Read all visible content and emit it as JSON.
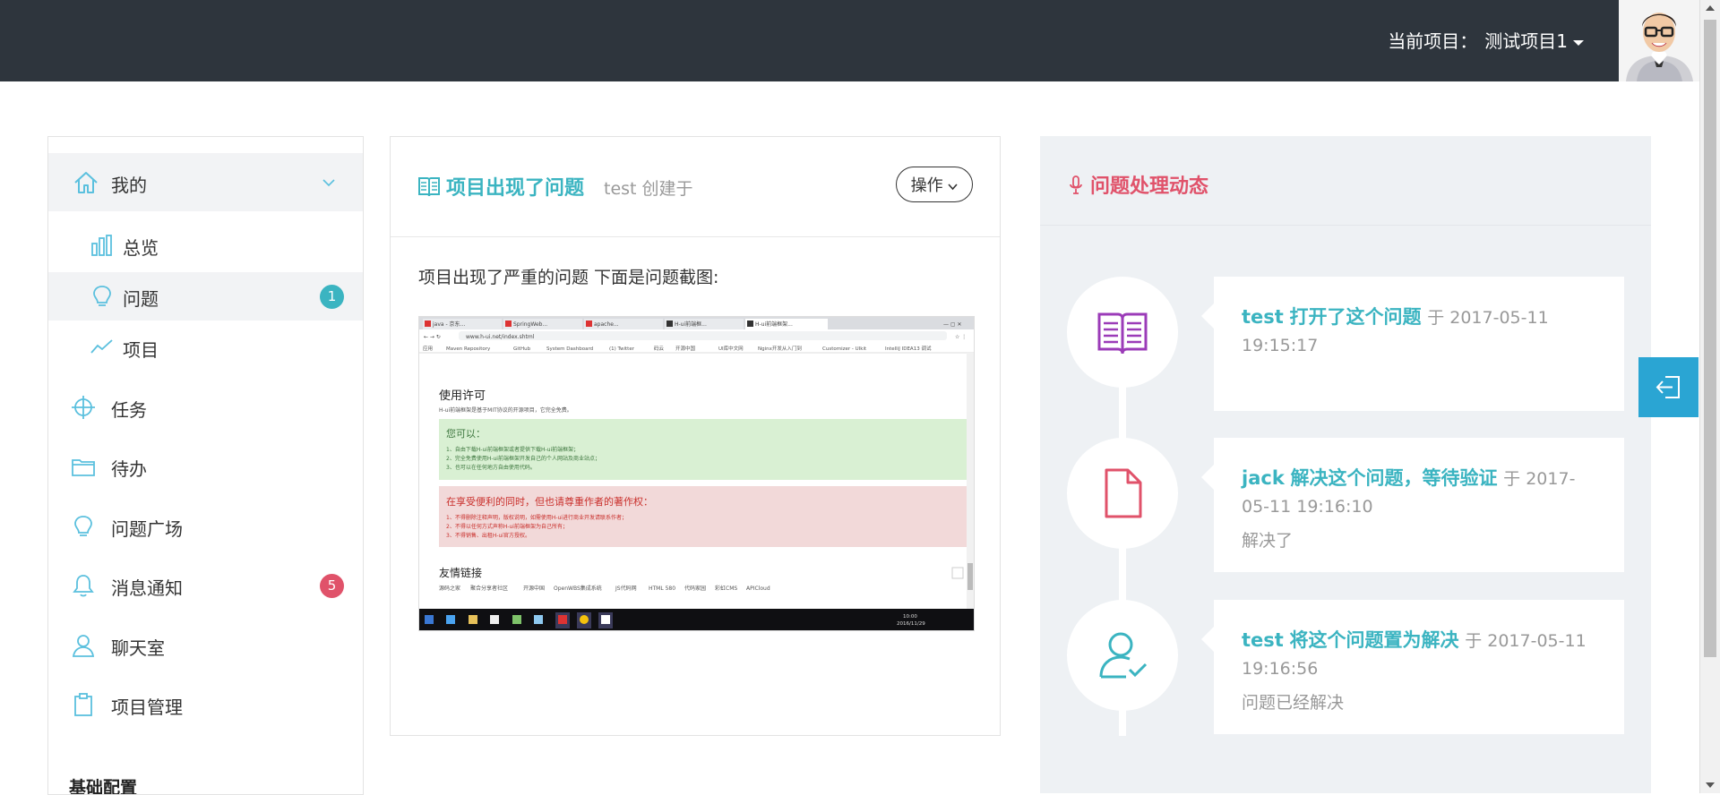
{
  "header": {
    "project_label": "当前项目：",
    "project_name": "测试项目1"
  },
  "sidebar": {
    "group": "我的",
    "items": [
      {
        "label": "总览",
        "icon": "bar-chart-icon"
      },
      {
        "label": "问题",
        "icon": "lightbulb-icon",
        "badge": "1",
        "badge_color": "#3bb4c1"
      },
      {
        "label": "项目",
        "icon": "trend-line-icon"
      },
      {
        "label": "任务",
        "icon": "crosshair-icon"
      },
      {
        "label": "待办",
        "icon": "folder-icon"
      },
      {
        "label": "问题广场",
        "icon": "lightbulb-icon"
      },
      {
        "label": "消息通知",
        "icon": "bell-icon",
        "badge": "5",
        "badge_color": "#e0526a"
      },
      {
        "label": "聊天室",
        "icon": "user-icon"
      },
      {
        "label": "项目管理",
        "icon": "clipboard-icon"
      }
    ],
    "section": "基础配置"
  },
  "issue": {
    "title": "项目出现了问题",
    "author": "test",
    "created": "创建于",
    "action_button": "操作",
    "description": "项目出现了严重的问题 下面是问题截图:",
    "screenshot": {
      "tabs": [
        "java - 京东...",
        "SpringWeb...",
        "apache...",
        "H-ui前端框...",
        "H-ui前端框架..."
      ],
      "url": "www.h-ui.net/index.shtml",
      "bookmarks": [
        "应用",
        "Maven Repository",
        "GitHub",
        "System Dashboard",
        "(1) Twitter",
        "码云",
        "开源中国",
        "UI库中文网",
        "Nginx开发从入门到",
        "Customizer - UIkit",
        "IntelliJ IDEA13 调试"
      ],
      "license_title": "使用许可",
      "license_text": "H-ui前端框架是基于MIT协议的开源项目，它完全免费。",
      "can_title": "您可以：",
      "can_items": [
        "1、自由下载H-ui前端框架或者提供下载H-ui前端框架；",
        "2、完全免费使用H-ui前端框架开发自己的个人网站及商业站点；",
        "3、也可以在任何地方自由使用代码。"
      ],
      "respect_title": "在享受便利的同时，但也请尊重作者的著作权：",
      "respect_items": [
        "1、不得删除注释声明，版权说明，如需使用H-ui进行商业开发请联系作者；",
        "2、不得以任何方式声称H-ui前端框架为自己所有；",
        "3、不得销售、出租H-ui官方授权。"
      ],
      "links_title": "友情链接",
      "links": [
        "源码之家",
        "聚合分享者社区",
        "开源中国",
        "OpenWBS集成系统",
        "JS代码网",
        "HTML 580",
        "代码家园",
        "彩虹CMS",
        "APICloud"
      ],
      "clock": "10:00",
      "date": "2016/11/29"
    }
  },
  "activity": {
    "title": "问题处理动态",
    "events": [
      {
        "actor": "test",
        "action": "打开了这个问题",
        "at": "于 2017-05-11 19:15:17",
        "note": "",
        "icon": "book-icon",
        "icon_color": "#9b3bb8"
      },
      {
        "actor": "jack",
        "action": "解决这个问题，等待验证",
        "at": "于 2017-05-11 19:16:10",
        "note": "解决了",
        "icon": "document-icon",
        "icon_color": "#e0526a"
      },
      {
        "actor": "test",
        "action": "将这个问题置为解决",
        "at": "于 2017-05-11 19:16:56",
        "note": "问题已经解决",
        "icon": "user-check-icon",
        "icon_color": "#3bb4c1"
      }
    ]
  },
  "colors": {
    "accent": "#3bb4c1",
    "danger": "#e0526a",
    "topbar": "#2e353d",
    "float": "#2aa5d3"
  }
}
